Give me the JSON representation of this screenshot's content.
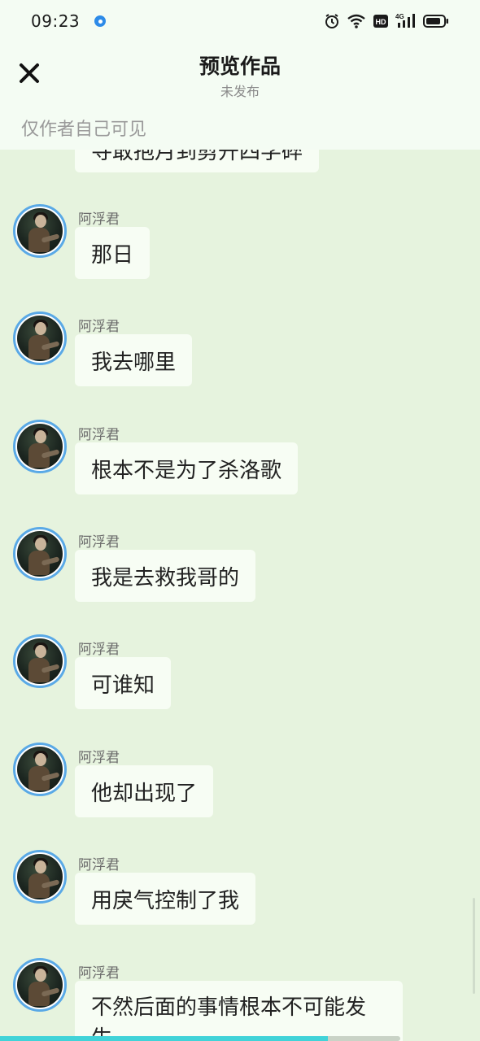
{
  "status_bar": {
    "time": "09:23",
    "icons": [
      "notification-dot-icon",
      "alarm-icon",
      "wifi-icon",
      "hd-icon",
      "4g-signal-icon",
      "battery-icon"
    ],
    "network_label": "4G",
    "hd_label": "HD"
  },
  "header": {
    "close_icon": "close-icon",
    "title": "预览作品",
    "subtitle": "未发布",
    "visibility_note": "仅作者自己可见"
  },
  "chat": {
    "partial_message": "寻敢抱月到剪开四学碎",
    "messages": [
      {
        "sender": "阿浮君",
        "text": "那日"
      },
      {
        "sender": "阿浮君",
        "text": "我去哪里"
      },
      {
        "sender": "阿浮君",
        "text": "根本不是为了杀洛歌"
      },
      {
        "sender": "阿浮君",
        "text": "我是去救我哥的"
      },
      {
        "sender": "阿浮君",
        "text": "可谁知"
      },
      {
        "sender": "阿浮君",
        "text": "他却出现了"
      },
      {
        "sender": "阿浮君",
        "text": "用戾气控制了我"
      },
      {
        "sender": "阿浮君",
        "text": "不然后面的事情根本不可能发生"
      }
    ]
  },
  "progress": {
    "fraction": 0.82,
    "color": "#41d3d8"
  },
  "colors": {
    "background": "#e6f3de",
    "header_background": "#f4fcf3",
    "bubble": "#f7fdf4",
    "avatar_ring": "#5aa9e6",
    "status_dot": "#2d8be8"
  }
}
